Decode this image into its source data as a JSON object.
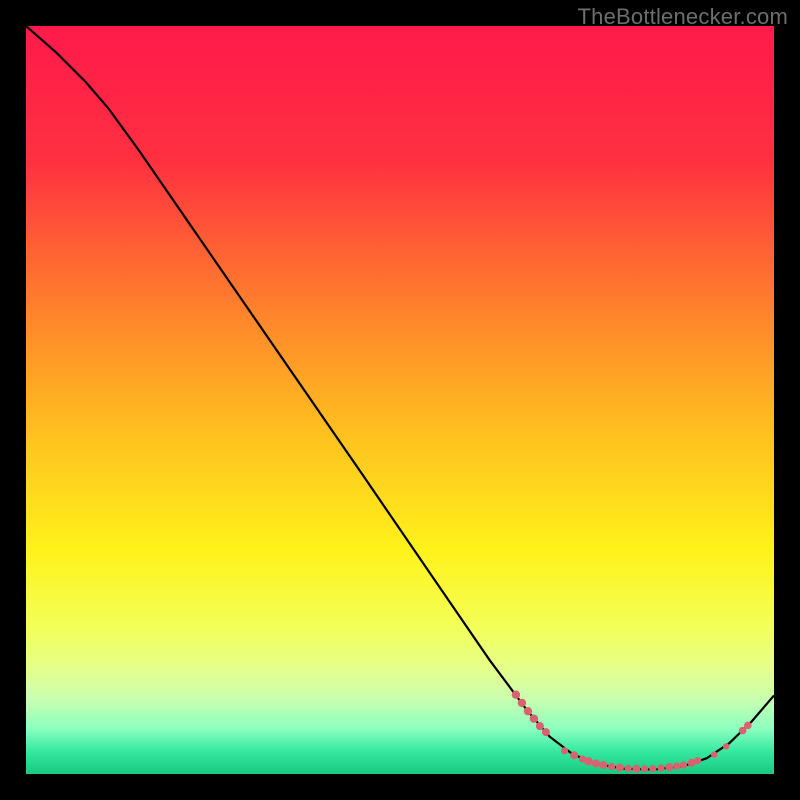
{
  "watermark": "TheBottlenecker.com",
  "chart_data": {
    "type": "line",
    "title": "",
    "xlabel": "",
    "ylabel": "",
    "xlim": [
      0,
      100
    ],
    "ylim": [
      0,
      100
    ],
    "gradient_stops": [
      {
        "offset": 0,
        "color": "#ff1a4b"
      },
      {
        "offset": 18,
        "color": "#ff3040"
      },
      {
        "offset": 40,
        "color": "#ff8a2a"
      },
      {
        "offset": 55,
        "color": "#ffc21f"
      },
      {
        "offset": 70,
        "color": "#fff21a"
      },
      {
        "offset": 80,
        "color": "#f3ff55"
      },
      {
        "offset": 86,
        "color": "#e5ff8c"
      },
      {
        "offset": 90,
        "color": "#c9ffb0"
      },
      {
        "offset": 94,
        "color": "#8affc0"
      },
      {
        "offset": 97,
        "color": "#35e8a0"
      },
      {
        "offset": 100,
        "color": "#18c982"
      }
    ],
    "series": [
      {
        "name": "curve",
        "color": "#000000",
        "points": [
          {
            "x": 0,
            "y": 100
          },
          {
            "x": 4,
            "y": 96.5
          },
          {
            "x": 8,
            "y": 92.5
          },
          {
            "x": 11,
            "y": 89
          },
          {
            "x": 15,
            "y": 83.5
          },
          {
            "x": 25,
            "y": 69
          },
          {
            "x": 35,
            "y": 54.5
          },
          {
            "x": 45,
            "y": 40
          },
          {
            "x": 55,
            "y": 25.4
          },
          {
            "x": 62,
            "y": 15.2
          },
          {
            "x": 67,
            "y": 8.5
          },
          {
            "x": 70,
            "y": 5.0
          },
          {
            "x": 73,
            "y": 2.7
          },
          {
            "x": 76,
            "y": 1.4
          },
          {
            "x": 80,
            "y": 0.7
          },
          {
            "x": 84,
            "y": 0.6
          },
          {
            "x": 88,
            "y": 1.1
          },
          {
            "x": 91,
            "y": 2.1
          },
          {
            "x": 94,
            "y": 4.1
          },
          {
            "x": 97,
            "y": 7.0
          },
          {
            "x": 100,
            "y": 10.5
          }
        ]
      }
    ],
    "markers": {
      "color": "#d9626e",
      "groups": [
        {
          "label": "left-cluster",
          "points": [
            {
              "x": 65.5,
              "y": 10.6,
              "r": 4.2
            },
            {
              "x": 66.3,
              "y": 9.5,
              "r": 4.2
            },
            {
              "x": 67.1,
              "y": 8.4,
              "r": 4.2
            },
            {
              "x": 67.9,
              "y": 7.4,
              "r": 4.2
            },
            {
              "x": 68.7,
              "y": 6.4,
              "r": 4.0
            },
            {
              "x": 69.5,
              "y": 5.6,
              "r": 4.0
            }
          ]
        },
        {
          "label": "bottom-cluster",
          "points": [
            {
              "x": 72.0,
              "y": 3.1,
              "r": 3.6
            },
            {
              "x": 73.3,
              "y": 2.5,
              "r": 4.0
            },
            {
              "x": 74.4,
              "y": 2.0,
              "r": 3.6
            },
            {
              "x": 75.2,
              "y": 1.7,
              "r": 4.2
            },
            {
              "x": 76.2,
              "y": 1.4,
              "r": 4.0
            },
            {
              "x": 77.2,
              "y": 1.2,
              "r": 4.0
            },
            {
              "x": 78.3,
              "y": 1.0,
              "r": 3.6
            },
            {
              "x": 79.4,
              "y": 0.85,
              "r": 4.0
            },
            {
              "x": 80.5,
              "y": 0.75,
              "r": 3.6
            },
            {
              "x": 81.6,
              "y": 0.7,
              "r": 4.0
            },
            {
              "x": 82.7,
              "y": 0.7,
              "r": 3.6
            },
            {
              "x": 83.8,
              "y": 0.72,
              "r": 3.6
            },
            {
              "x": 84.9,
              "y": 0.8,
              "r": 3.6
            },
            {
              "x": 86.0,
              "y": 0.92,
              "r": 4.0
            },
            {
              "x": 87.0,
              "y": 1.05,
              "r": 3.6
            },
            {
              "x": 87.9,
              "y": 1.2,
              "r": 3.6
            },
            {
              "x": 89.0,
              "y": 1.5,
              "r": 4.0
            },
            {
              "x": 89.8,
              "y": 1.8,
              "r": 3.6
            }
          ]
        },
        {
          "label": "right-cluster",
          "points": [
            {
              "x": 92.0,
              "y": 2.6,
              "r": 3.2
            },
            {
              "x": 93.6,
              "y": 3.7,
              "r": 3.2
            },
            {
              "x": 95.8,
              "y": 5.8,
              "r": 3.8
            },
            {
              "x": 96.5,
              "y": 6.5,
              "r": 3.8
            }
          ]
        }
      ]
    }
  }
}
